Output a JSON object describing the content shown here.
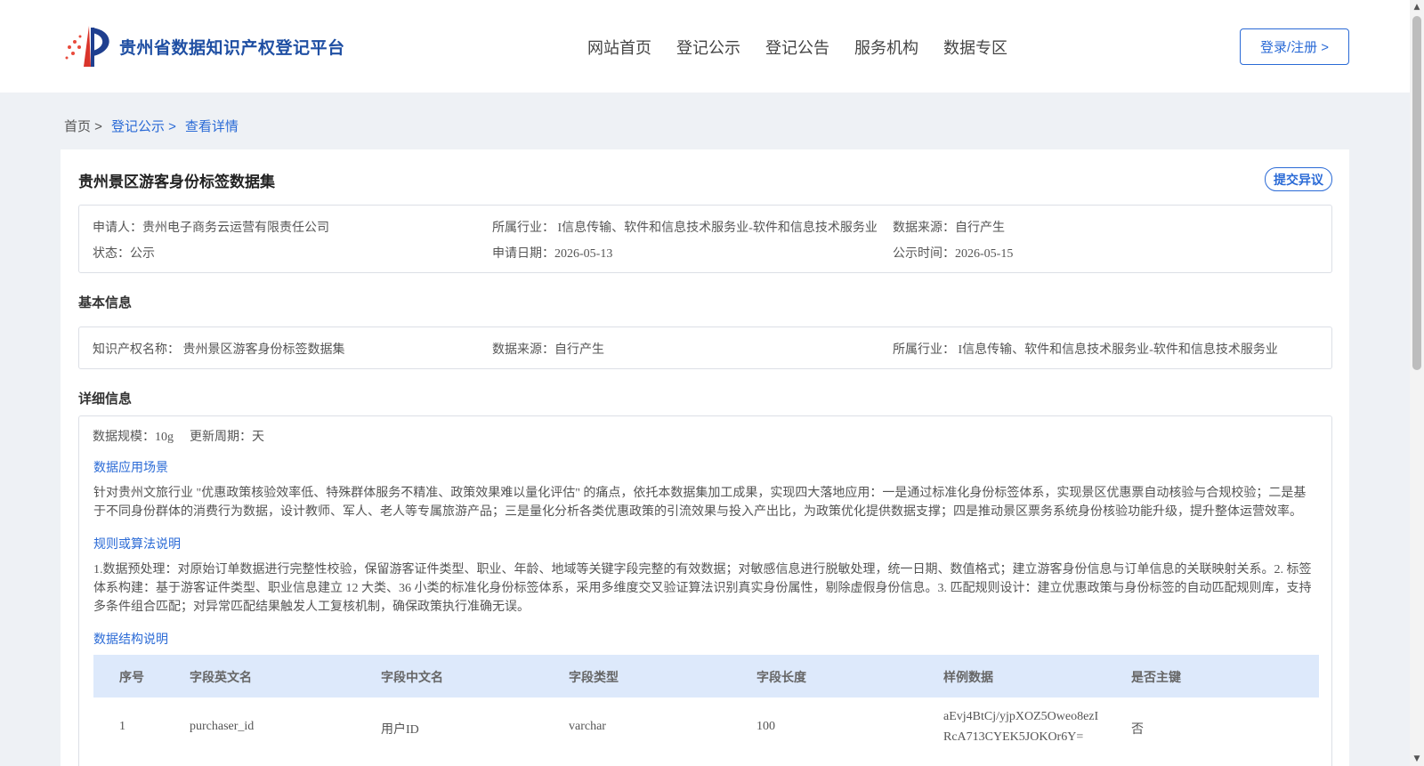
{
  "header": {
    "logo_text": "贵州省数据知识产权登记平台",
    "nav": [
      "网站首页",
      "登记公示",
      "登记公告",
      "服务机构",
      "数据专区"
    ],
    "login_label": "登录/注册 >"
  },
  "breadcrumb": {
    "home": "首页 >",
    "items": [
      "登记公示 >",
      "查看详情"
    ]
  },
  "detail": {
    "title": "贵州景区游客身份标签数据集",
    "objection_label": "提交异议",
    "summary": {
      "applicant": "申请人：贵州电子商务云运营有限责任公司",
      "industry": "所属行业： I信息传输、软件和信息技术服务业-软件和信息技术服务业",
      "source": "数据来源：自行产生",
      "status": "状态：公示",
      "apply_date": "申请日期：2026-05-13",
      "publish_date": "公示时间：2026-05-15"
    },
    "basic": {
      "heading": "基本信息",
      "ip_name": "知识产权名称： 贵州景区游客身份标签数据集",
      "source": "数据来源：自行产生",
      "industry": "所属行业： I信息传输、软件和信息技术服务业-软件和信息技术服务业"
    },
    "details": {
      "heading": "详细信息",
      "scale": "数据规模：10g",
      "cycle": "更新周期：天",
      "scene_title": "数据应用场景",
      "scene_text": "针对贵州文旅行业 \"优惠政策核验效率低、特殊群体服务不精准、政策效果难以量化评估\" 的痛点，依托本数据集加工成果，实现四大落地应用：一是通过标准化身份标签体系，实现景区优惠票自动核验与合规校验；二是基于不同身份群体的消费行为数据，设计教师、军人、老人等专属旅游产品；三是量化分析各类优惠政策的引流效果与投入产出比，为政策优化提供数据支撑；四是推动景区票务系统身份核验功能升级，提升整体运营效率。",
      "rule_title": "规则或算法说明",
      "rule_text": "1.数据预处理：对原始订单数据进行完整性校验，保留游客证件类型、职业、年龄、地域等关键字段完整的有效数据；对敏感信息进行脱敏处理，统一日期、数值格式；建立游客身份信息与订单信息的关联映射关系。2. 标签体系构建：基于游客证件类型、职业信息建立 12 大类、36 小类的标准化身份标签体系，采用多维度交叉验证算法识别真实身份属性，剔除虚假身份信息。3. 匹配规则设计：建立优惠政策与身份标签的自动匹配规则库，支持多条件组合匹配；对异常匹配结果触发人工复核机制，确保政策执行准确无误。",
      "structure_title": "数据结构说明"
    },
    "table": {
      "headers": [
        "序号",
        "字段英文名",
        "字段中文名",
        "字段类型",
        "字段长度",
        "样例数据",
        "是否主键"
      ],
      "rows": [
        {
          "no": "1",
          "en": "purchaser_id",
          "cn": "用户ID",
          "type": "varchar",
          "length": "100",
          "sample_1": "aEvj4BtCj/yjpXOZ5Oweo8ezI",
          "sample_2": "RcA713CYEK5JOKOr6Y=",
          "pk": "否"
        }
      ]
    }
  },
  "colors": {
    "brand": "#1f4fa3",
    "link": "#2a6ad6",
    "table_header_bg": "#dde9fb",
    "page_bg": "#eef1f5"
  },
  "icons": [
    "logo-mark",
    "scroll-up-arrow",
    "scroll-down-arrow"
  ]
}
